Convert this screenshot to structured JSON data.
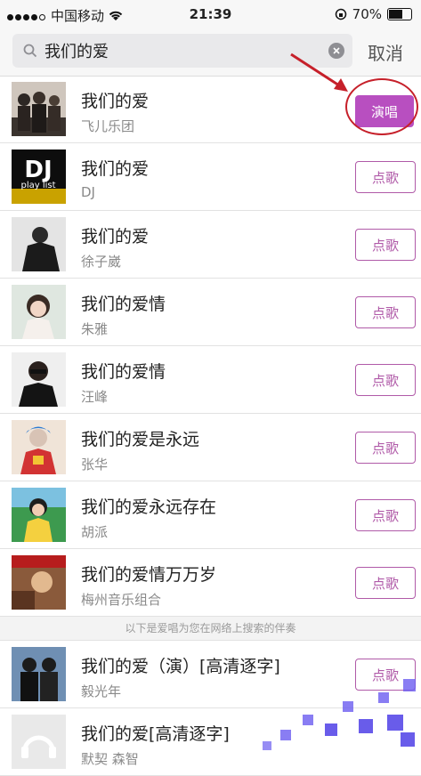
{
  "status": {
    "carrier": "中国移动",
    "time": "21:39",
    "battery": "70%",
    "battery_level": 0.7
  },
  "search": {
    "query": "我们的爱",
    "cancel_label": "取消"
  },
  "songs": [
    {
      "title": "我们的爱",
      "artist": "飞儿乐团",
      "action": "演唱"
    },
    {
      "title": "我们的爱",
      "artist": "DJ",
      "action": "点歌"
    },
    {
      "title": "我们的爱",
      "artist": "徐子崴",
      "action": "点歌"
    },
    {
      "title": "我们的爱情",
      "artist": "朱雅",
      "action": "点歌"
    },
    {
      "title": "我们的爱情",
      "artist": "汪峰",
      "action": "点歌"
    },
    {
      "title": "我们的爱是永远",
      "artist": "张华",
      "action": "点歌"
    },
    {
      "title": "我们的爱永远存在",
      "artist": "胡派",
      "action": "点歌"
    },
    {
      "title": "我们的爱情万万岁",
      "artist": "梅州音乐组合",
      "action": "点歌"
    }
  ],
  "divider_text": "以下是爱唱为您在网络上搜索的伴奏",
  "web_songs": [
    {
      "title": "我们的爱（演）[高清逐字]",
      "artist": "毅光年",
      "action": "点歌"
    },
    {
      "title": "我们的爱[高清逐字]",
      "artist": "默契 森智"
    }
  ],
  "dj_thumb": {
    "line1": "DJ",
    "line2": "play list"
  },
  "colors": {
    "accent": "#b84fc0",
    "annotation": "#c6202a"
  }
}
